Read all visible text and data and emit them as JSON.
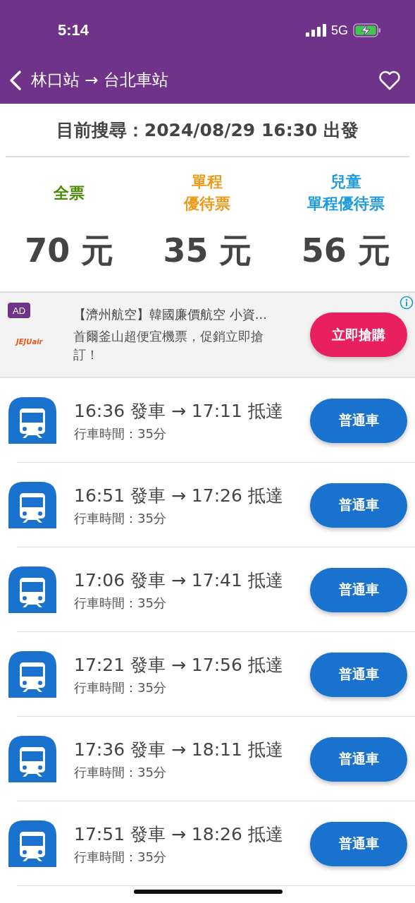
{
  "status_bar": {
    "time": "5:14",
    "network": "5G"
  },
  "nav": {
    "title": "林口站 → 台北車站"
  },
  "search": {
    "text": "目前搜尋：2024/08/29 16:30 出發"
  },
  "fares": [
    {
      "label": [
        "全票"
      ],
      "price": "70 元",
      "color": "#4a8a05"
    },
    {
      "label": [
        "單程",
        "優待票"
      ],
      "price": "35 元",
      "color": "#f09a1c"
    },
    {
      "label": [
        "兒童",
        "單程優待票"
      ],
      "price": "56 元",
      "color": "#1e9ae0"
    }
  ],
  "ad": {
    "badge": "AD",
    "brand": "JEJUair",
    "title": "【濟州航空】韓國廉價航空 小資...",
    "body": "首爾釜山超便宜機票，促銷立即搶訂！",
    "button": "立即搶購"
  },
  "trains": [
    {
      "times": "16:36 發車 → 17:11 抵達",
      "duration": "行車時間：35分",
      "type": "普通車"
    },
    {
      "times": "16:51 發車 → 17:26 抵達",
      "duration": "行車時間：35分",
      "type": "普通車"
    },
    {
      "times": "17:06 發車 → 17:41 抵達",
      "duration": "行車時間：35分",
      "type": "普通車"
    },
    {
      "times": "17:21 發車 → 17:56 抵達",
      "duration": "行車時間：35分",
      "type": "普通車"
    },
    {
      "times": "17:36 發車 → 18:11 抵達",
      "duration": "行車時間：35分",
      "type": "普通車"
    },
    {
      "times": "17:51 發車 → 18:26 抵達",
      "duration": "行車時間：35分",
      "type": "普通車"
    }
  ]
}
